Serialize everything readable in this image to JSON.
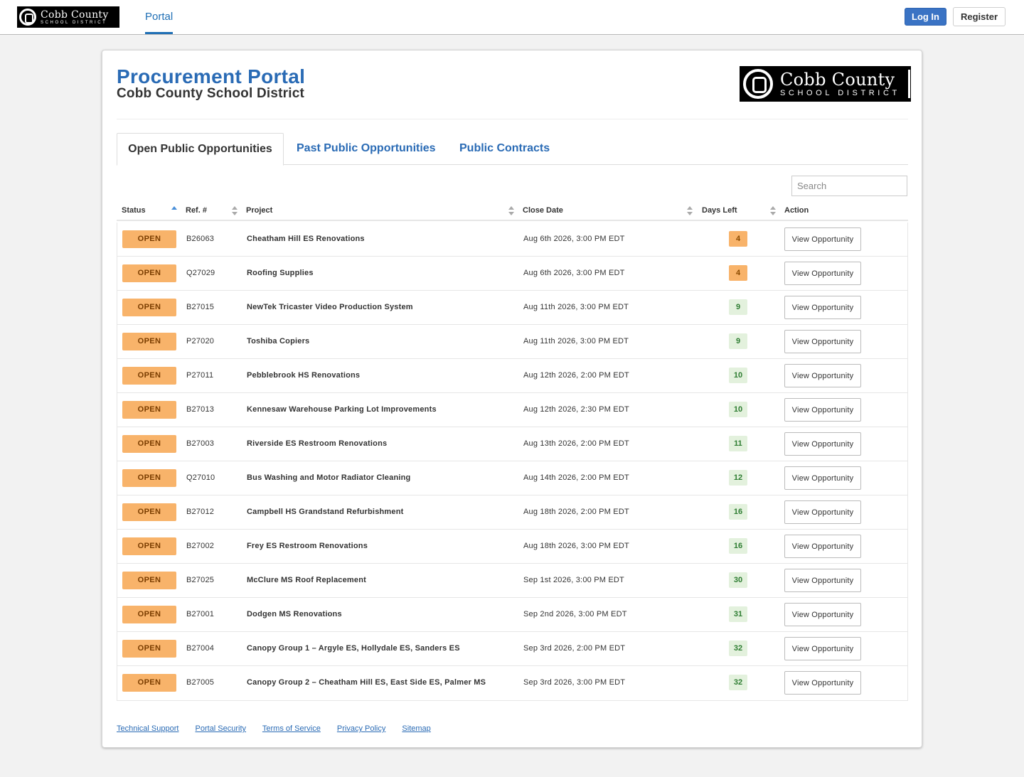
{
  "header": {
    "logo_line1": "Cobb County",
    "logo_line2": "SCHOOL DISTRICT",
    "nav_portal": "Portal",
    "login_label": "Log In",
    "register_label": "Register"
  },
  "page": {
    "title": "Procurement Portal",
    "subtitle": "Cobb County School District",
    "logo_line1": "Cobb County",
    "logo_line2": "SCHOOL DISTRICT"
  },
  "tabs": [
    {
      "label": "Open Public Opportunities",
      "active": true
    },
    {
      "label": "Past Public Opportunities",
      "active": false
    },
    {
      "label": "Public Contracts",
      "active": false
    }
  ],
  "search": {
    "placeholder": "Search"
  },
  "table": {
    "columns": [
      "Status",
      "Ref. #",
      "Project",
      "Close Date",
      "Days Left",
      "Action"
    ],
    "sorted_by": "Status",
    "sort_direction": "ascending",
    "rows": [
      {
        "status": "OPEN",
        "ref": "B26063",
        "project": "Cheatham Hill ES Renovations",
        "close_date": "Aug 6th 2026, 3:00 PM EDT",
        "days_left": "4",
        "days_level": "warn",
        "action": "View Opportunity"
      },
      {
        "status": "OPEN",
        "ref": "Q27029",
        "project": "Roofing Supplies",
        "close_date": "Aug 6th 2026, 3:00 PM EDT",
        "days_left": "4",
        "days_level": "warn",
        "action": "View Opportunity"
      },
      {
        "status": "OPEN",
        "ref": "B27015",
        "project": "NewTek Tricaster Video Production System",
        "close_date": "Aug 11th 2026, 3:00 PM EDT",
        "days_left": "9",
        "days_level": "ok",
        "action": "View Opportunity"
      },
      {
        "status": "OPEN",
        "ref": "P27020",
        "project": "Toshiba Copiers",
        "close_date": "Aug 11th 2026, 3:00 PM EDT",
        "days_left": "9",
        "days_level": "ok",
        "action": "View Opportunity"
      },
      {
        "status": "OPEN",
        "ref": "P27011",
        "project": "Pebblebrook HS Renovations",
        "close_date": "Aug 12th 2026, 2:00 PM EDT",
        "days_left": "10",
        "days_level": "ok",
        "action": "View Opportunity"
      },
      {
        "status": "OPEN",
        "ref": "B27013",
        "project": "Kennesaw Warehouse Parking Lot Improvements",
        "close_date": "Aug 12th 2026, 2:30 PM EDT",
        "days_left": "10",
        "days_level": "ok",
        "action": "View Opportunity"
      },
      {
        "status": "OPEN",
        "ref": "B27003",
        "project": "Riverside ES Restroom Renovations",
        "close_date": "Aug 13th 2026, 2:00 PM EDT",
        "days_left": "11",
        "days_level": "ok",
        "action": "View Opportunity"
      },
      {
        "status": "OPEN",
        "ref": "Q27010",
        "project": "Bus Washing and Motor Radiator Cleaning",
        "close_date": "Aug 14th 2026, 2:00 PM EDT",
        "days_left": "12",
        "days_level": "ok",
        "action": "View Opportunity"
      },
      {
        "status": "OPEN",
        "ref": "B27012",
        "project": "Campbell HS Grandstand Refurbishment",
        "close_date": "Aug 18th 2026, 2:00 PM EDT",
        "days_left": "16",
        "days_level": "ok",
        "action": "View Opportunity"
      },
      {
        "status": "OPEN",
        "ref": "B27002",
        "project": "Frey ES Restroom Renovations",
        "close_date": "Aug 18th 2026, 3:00 PM EDT",
        "days_left": "16",
        "days_level": "ok",
        "action": "View Opportunity"
      },
      {
        "status": "OPEN",
        "ref": "B27025",
        "project": "McClure MS Roof Replacement",
        "close_date": "Sep 1st 2026, 3:00 PM EDT",
        "days_left": "30",
        "days_level": "ok",
        "action": "View Opportunity"
      },
      {
        "status": "OPEN",
        "ref": "B27001",
        "project": "Dodgen MS Renovations",
        "close_date": "Sep 2nd 2026, 3:00 PM EDT",
        "days_left": "31",
        "days_level": "ok",
        "action": "View Opportunity"
      },
      {
        "status": "OPEN",
        "ref": "B27004",
        "project": "Canopy Group 1 – Argyle ES, Hollydale ES, Sanders ES",
        "close_date": "Sep 3rd 2026, 2:00 PM EDT",
        "days_left": "32",
        "days_level": "ok",
        "action": "View Opportunity"
      },
      {
        "status": "OPEN",
        "ref": "B27005",
        "project": "Canopy Group 2 – Cheatham Hill ES, East Side ES, Palmer MS",
        "close_date": "Sep 3rd 2026, 3:00 PM EDT",
        "days_left": "32",
        "days_level": "ok",
        "action": "View Opportunity"
      }
    ]
  },
  "footer": {
    "links": [
      "Technical Support",
      "Portal Security",
      "Terms of Service",
      "Privacy Policy",
      "Sitemap"
    ]
  },
  "colors": {
    "accent": "#2a6bb5",
    "open_badge": "#f8b36a",
    "days_warn": "#f8b36a",
    "days_ok": "#e3f1dd",
    "login_button": "#3a73c4"
  }
}
